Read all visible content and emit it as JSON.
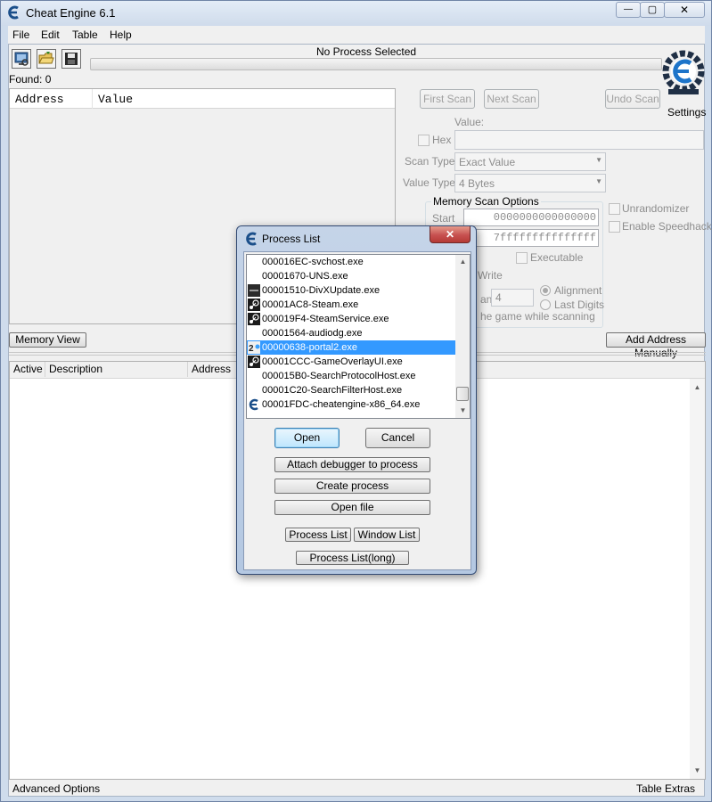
{
  "window": {
    "title": "Cheat Engine 6.1",
    "controls": {
      "minimize": "—",
      "maximize": "▢",
      "close": "✕"
    }
  },
  "menu": [
    "File",
    "Edit",
    "Table",
    "Help"
  ],
  "toolbar": {
    "icons": [
      "open-process-icon",
      "open-folder-icon",
      "save-icon"
    ],
    "process_label": "No Process Selected",
    "progress": 0
  },
  "found_label": "Found: 0",
  "results_table": {
    "columns": [
      "Address",
      "Value"
    ]
  },
  "scan": {
    "first_scan": "First Scan",
    "next_scan": "Next Scan",
    "undo_scan": "Undo Scan",
    "settings": "Settings",
    "value_label": "Value:",
    "hex_label": "Hex",
    "scan_type_label": "Scan Type",
    "scan_type_value": "Exact Value",
    "value_type_label": "Value Type",
    "value_type_value": "4 Bytes",
    "memory_options_title": "Memory Scan Options",
    "start_label": "Start",
    "start_value": "0000000000000000",
    "stop_value_partial": "7fffffffffffffff",
    "executable_label": "Executable",
    "write_partial": "Write",
    "an_partial": "an",
    "fastscan_value": "4",
    "alignment_label": "Alignment",
    "last_digits_label": "Last Digits",
    "pause_partial": "he game while scanning",
    "unrandomizer_label": "Unrandomizer",
    "speedhack_label": "Enable Speedhack"
  },
  "memory_view_button": "Memory View",
  "add_address_button": "Add Address Manually",
  "address_list": {
    "columns": [
      "Active",
      "Description",
      "Address"
    ]
  },
  "bottom": {
    "advanced": "Advanced Options",
    "extras": "Table Extras"
  },
  "dialog": {
    "title": "Process List",
    "close": "✕",
    "processes": [
      {
        "name": "000016EC-svchost.exe",
        "icon": "",
        "selected": false
      },
      {
        "name": "00001670-UNS.exe",
        "icon": "",
        "selected": false
      },
      {
        "name": "00001510-DivXUpdate.exe",
        "icon": "divx-icon",
        "selected": false
      },
      {
        "name": "00001AC8-Steam.exe",
        "icon": "steam-icon",
        "selected": false
      },
      {
        "name": "000019F4-SteamService.exe",
        "icon": "steam-icon",
        "selected": false
      },
      {
        "name": "00001564-audiodg.exe",
        "icon": "",
        "selected": false
      },
      {
        "name": "00000638-portal2.exe",
        "icon": "portal2-icon",
        "selected": true
      },
      {
        "name": "00001CCC-GameOverlayUI.exe",
        "icon": "steam-icon",
        "selected": false
      },
      {
        "name": "000015B0-SearchProtocolHost.exe",
        "icon": "",
        "selected": false
      },
      {
        "name": "00001C20-SearchFilterHost.exe",
        "icon": "",
        "selected": false
      },
      {
        "name": "00001FDC-cheatengine-x86_64.exe",
        "icon": "cheat-engine-icon",
        "selected": false
      }
    ],
    "buttons": {
      "open": "Open",
      "cancel": "Cancel",
      "attach": "Attach debugger to process",
      "create": "Create process",
      "open_file": "Open file",
      "process_list": "Process List",
      "window_list": "Window List",
      "process_list_long": "Process List(long)"
    }
  },
  "colors": {
    "selection": "#3399ff",
    "titlebar": "#cfdbeb",
    "dialog_close": "#c75050"
  }
}
